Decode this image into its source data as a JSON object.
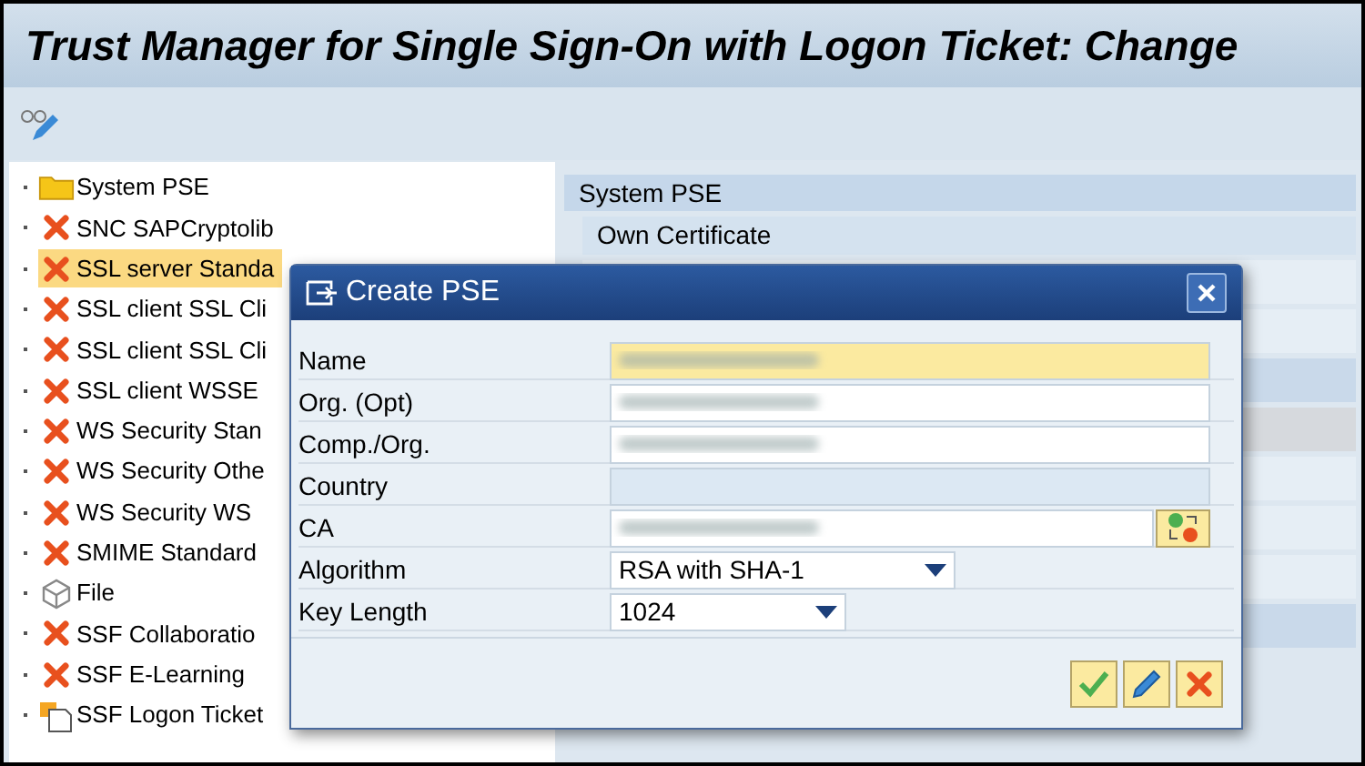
{
  "window": {
    "title": "Trust Manager for Single Sign-On with Logon Ticket: Change"
  },
  "tree": {
    "items": [
      {
        "label": "System PSE",
        "kind": "folder",
        "selected": false
      },
      {
        "label": "SNC SAPCryptolib",
        "kind": "missing",
        "selected": false
      },
      {
        "label": "SSL server Standa",
        "kind": "missing",
        "selected": true
      },
      {
        "label": "SSL client SSL Cli",
        "kind": "missing",
        "selected": false
      },
      {
        "label": "SSL client SSL Cli",
        "kind": "missing",
        "selected": false
      },
      {
        "label": "SSL client WSSE",
        "kind": "missing",
        "selected": false
      },
      {
        "label": "WS Security Stan",
        "kind": "missing",
        "selected": false
      },
      {
        "label": "WS Security Othe",
        "kind": "missing",
        "selected": false
      },
      {
        "label": "WS Security WS",
        "kind": "missing",
        "selected": false
      },
      {
        "label": "SMIME Standard",
        "kind": "missing",
        "selected": false
      },
      {
        "label": "File",
        "kind": "file",
        "selected": false
      },
      {
        "label": "SSF Collaboratio",
        "kind": "missing",
        "selected": false
      },
      {
        "label": "SSF E-Learning",
        "kind": "missing",
        "selected": false
      },
      {
        "label": "SSF Logon Ticket",
        "kind": "ticket",
        "selected": false
      }
    ]
  },
  "detail": {
    "header": "System PSE",
    "section": "Own Certificate"
  },
  "dialog": {
    "title": "Create PSE",
    "fields": [
      {
        "label": "Name",
        "kind": "text",
        "required": true,
        "disabled": false,
        "redacted": true
      },
      {
        "label": "Org. (Opt)",
        "kind": "text",
        "required": false,
        "disabled": false,
        "redacted": true
      },
      {
        "label": "Comp./Org.",
        "kind": "text",
        "required": false,
        "disabled": false,
        "redacted": true
      },
      {
        "label": "Country",
        "kind": "text",
        "disabled": true,
        "redacted": false
      },
      {
        "label": "CA",
        "kind": "lookup",
        "required": false,
        "disabled": false,
        "redacted": true
      },
      {
        "label": "Algorithm",
        "kind": "dropdown",
        "value": "RSA with SHA-1"
      },
      {
        "label": "Key Length",
        "kind": "dropdown",
        "value": "1024"
      }
    ]
  }
}
